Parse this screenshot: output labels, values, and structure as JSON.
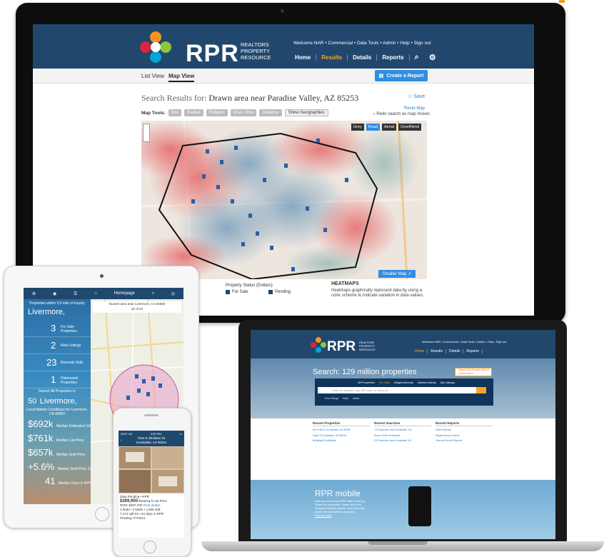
{
  "desktop": {
    "logo": {
      "text": "RPR",
      "subtitle": "REALTORS PROPERTY RESOURCE"
    },
    "topline": "Welcome NAR • Commercial • Data Tools • Admin • Help • Sign out",
    "nav": [
      "Home",
      "Results",
      "Details",
      "Reports"
    ],
    "nav_active_index": 1,
    "tabs": [
      "List View",
      "Map View"
    ],
    "selected_tab": "Map View",
    "create_report": "Create a Report",
    "search_results_label": "Search Results for:",
    "search_results_value": "Drawn area near Paradise Valley, AZ 85253",
    "save": "Save",
    "map_tools_label": "Map Tools:",
    "map_tools": [
      "Box",
      "Radius",
      "Polygon",
      "Drive Time",
      "Distance"
    ],
    "show_geographies": "Show Geographies",
    "reset_map": "Reset Map",
    "redo_search": "Redo search as map moves",
    "map_types": [
      "Grey",
      "Road",
      "Aerial",
      "OverBlend"
    ],
    "map_type_active": "Road",
    "smaller_map": "Smaller Map",
    "legend_title": "Property Status (Dollars)",
    "legend_items": [
      "For Sale",
      "Pending"
    ],
    "heatmaps_title": "HEATMAPS",
    "heatmaps_desc": "Heatmaps graphically represent data by using a color scheme to indicate variation in data values."
  },
  "tablet": {
    "toolbar_title": "Homepage",
    "properties_within": "Properties within 0.5 mile of inquiry",
    "city": "Livermore,",
    "stats": [
      {
        "value": "3",
        "label": "For Sale Properties"
      },
      {
        "value": "2",
        "label": "New Listings"
      },
      {
        "value": "23",
        "label": "Recently Sold"
      },
      {
        "value": "1",
        "label": "Distressed Properties"
      }
    ],
    "search_all_label": "Search All Properties in",
    "search_all_value": "50",
    "search_all_city": "Livermore,",
    "market_label": "Local Market Conditions for Livermore, CA 94550",
    "market": [
      {
        "value": "$692k",
        "label": "Median Estimated Value"
      },
      {
        "value": "$761k",
        "label": "Median List Price"
      },
      {
        "value": "$657k",
        "label": "Median Sold Price"
      },
      {
        "value": "+5.6%",
        "label": "Median Sold Price 12 Month"
      },
      {
        "value": "41",
        "label": "Median Days in RPR"
      }
    ],
    "map_address": "Duotrel area near Livermore, CA 94550",
    "map_count": "22 of 23"
  },
  "phone": {
    "status_left": "AT&T 4G",
    "status_time": "4:09 PM",
    "address_line1": "7334 E Whitaker Dr",
    "address_line2": "Scottsdale, AZ 85251",
    "status": "Data Pending • RPR",
    "price": "$289,900",
    "price_per_sqft": "$150/sq ft",
    "list_price": "List Price",
    "rvm": "RVM: $287,700",
    "rvm_link": "RVM details",
    "beds_baths": "4 beds • 2 baths • 1,936 sqft",
    "lot_info": "7,174 sqft lot • 34 days in RPR",
    "pending": "Pending 7/7/2014"
  },
  "laptop": {
    "logo": {
      "text": "RPR",
      "subtitle": "REALTORS PROPERTY RESOURCE"
    },
    "topline": "Welcome NAR • Commercial • Data Tools • Admin • Help • Sign out",
    "nav": [
      "Home",
      "Results",
      "Details",
      "Reports"
    ],
    "hero_title": "Search: 129 million properties",
    "promo": "Submit Get Results Save an Active search",
    "search_tabs": [
      "All Properties",
      "For Sale",
      "Neighborhoods",
      "Market Activity",
      "My Listings"
    ],
    "search_placeholder": "Enter an address, city, ZIP code, or listing ID",
    "filters": [
      "Price Range",
      "Beds",
      "Baths"
    ],
    "columns": [
      {
        "title": "Recent Properties",
        "entries": [
          "Red Hills Dr Scottsdale, AZ 85255",
          "Dade St Scottsdale, AZ 85260",
          "Bellfwight Scottsdale"
        ]
      },
      {
        "title": "Recent Searches",
        "entries": [
          "76 Properties near Scottsdale, AZ",
          "Stoner Vista Scottsdale",
          "24 Properties near Scottsdale, AZ"
        ]
      },
      {
        "title": "Recent Reports",
        "entries": [
          "Seller Reports",
          "Neighborhood Report",
          "View all Recent Reports"
        ]
      }
    ],
    "mobile_title": "RPR mobile",
    "mobile_desc": "Now you can access RPR while on the go. Search for properties, create and send company branded reports, and view local market trends anytime, anywhere.",
    "mobile_link": "Find out more"
  },
  "colors": {
    "header": "#21476d",
    "accent": "#f5a623",
    "link": "#2a7fd0",
    "button": "#2f8ee0"
  }
}
